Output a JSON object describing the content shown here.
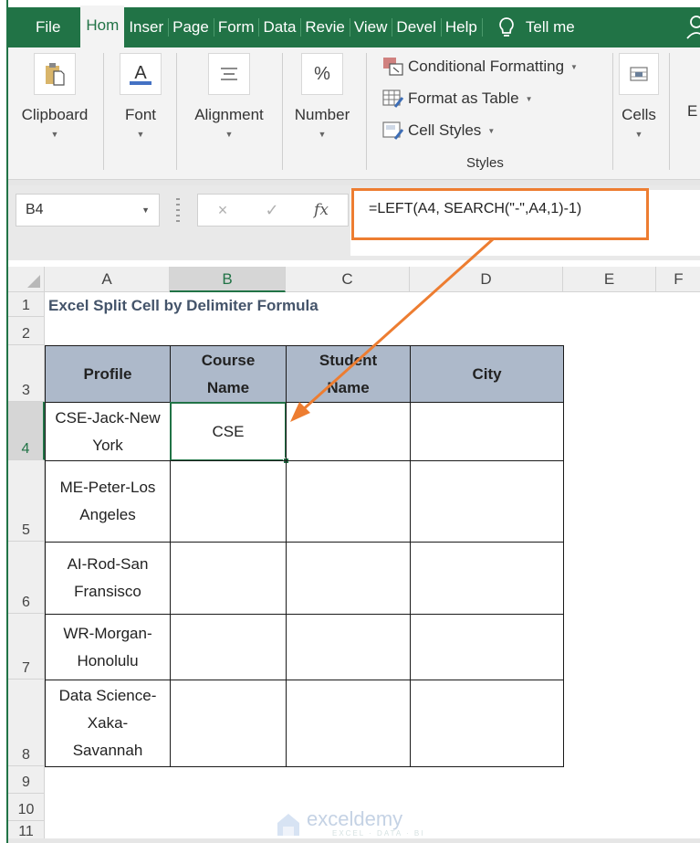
{
  "ribbon": {
    "tabs": [
      {
        "label": "File",
        "active": false
      },
      {
        "label": "Hom",
        "active": true
      },
      {
        "label": "Inser",
        "active": false
      },
      {
        "label": "Page",
        "active": false
      },
      {
        "label": "Form",
        "active": false
      },
      {
        "label": "Data",
        "active": false
      },
      {
        "label": "Revie",
        "active": false
      },
      {
        "label": "View",
        "active": false
      },
      {
        "label": "Devel",
        "active": false
      },
      {
        "label": "Help",
        "active": false
      }
    ],
    "tell_me": "Tell me",
    "groups": {
      "clipboard": "Clipboard",
      "font": "Font",
      "alignment": "Alignment",
      "number": "Number",
      "cells": "Cells",
      "editing_partial": "E"
    },
    "styles": {
      "conditional_formatting": "Conditional Formatting",
      "format_as_table": "Format as Table",
      "cell_styles": "Cell Styles",
      "group_label": "Styles"
    }
  },
  "formula_bar": {
    "name_box": "B4",
    "cancel_icon": "×",
    "enter_icon": "✓",
    "fx_label": "fx",
    "formula": "=LEFT(A4, SEARCH(\"-\",A4,1)-1)"
  },
  "sheet": {
    "columns": [
      "A",
      "B",
      "C",
      "D",
      "E",
      "F"
    ],
    "selected_column": "B",
    "rows": [
      "1",
      "2",
      "3",
      "4",
      "5",
      "6",
      "7",
      "8",
      "9",
      "10",
      "11"
    ],
    "selected_row": "4",
    "title": "Excel Split Cell by Delimiter Formula",
    "table": {
      "headers": [
        "Profile",
        "Course\nName",
        "Student\nName",
        "City"
      ],
      "header_lines": [
        [
          "Profile"
        ],
        [
          "Course",
          "Name"
        ],
        [
          "Student",
          "Name"
        ],
        [
          "City"
        ]
      ],
      "rows": [
        {
          "profile": [
            "CSE-Jack-New",
            "York"
          ],
          "course": "CSE",
          "student": "",
          "city": ""
        },
        {
          "profile": [
            "ME-Peter-Los",
            "Angeles"
          ],
          "course": "",
          "student": "",
          "city": ""
        },
        {
          "profile": [
            "AI-Rod-San",
            "Fransisco"
          ],
          "course": "",
          "student": "",
          "city": ""
        },
        {
          "profile": [
            "WR-Morgan-",
            "Honolulu"
          ],
          "course": "",
          "student": "",
          "city": ""
        },
        {
          "profile": [
            "Data Science-",
            "Xaka-",
            "Savannah"
          ],
          "course": "",
          "student": "",
          "city": ""
        }
      ]
    }
  },
  "watermark": {
    "brand": "exceldemy",
    "tagline": "EXCEL · DATA · BI"
  },
  "colors": {
    "excel_green": "#217346",
    "header_fill": "#adb9ca",
    "title_text": "#44546a",
    "callout_orange": "#ed7d31"
  }
}
